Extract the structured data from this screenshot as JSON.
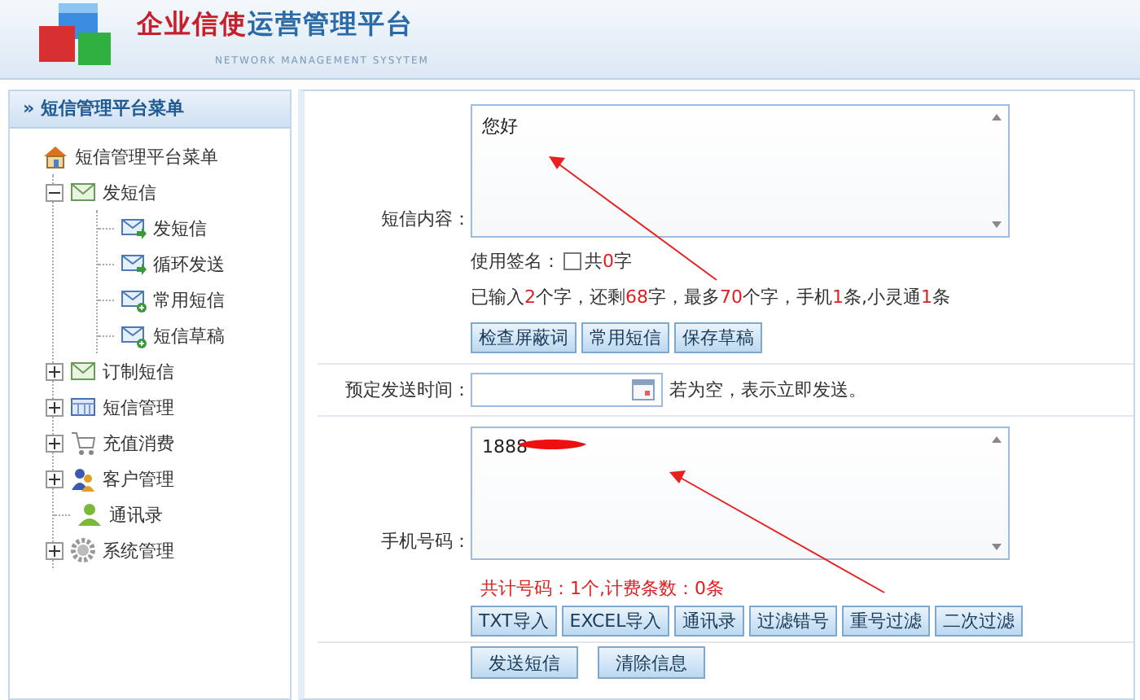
{
  "header": {
    "title_brand": "企业信使",
    "title_rest": "运营管理平台",
    "subtitle": "NETWORK MANAGEMENT SYSYTEM"
  },
  "sidebar": {
    "marker": "»",
    "title": "短信管理平台菜单",
    "tree": [
      {
        "label": "短信管理平台菜单",
        "kind": "home",
        "children": [
          {
            "label": "发短信",
            "kind": "mail",
            "expanded": true,
            "children": [
              {
                "label": "发短信",
                "kind": "mail-send"
              },
              {
                "label": "循环发送",
                "kind": "mail-send"
              },
              {
                "label": "常用短信",
                "kind": "mail-plus"
              },
              {
                "label": "短信草稿",
                "kind": "mail-plus"
              }
            ]
          },
          {
            "label": "订制短信",
            "kind": "mail",
            "expanded": false
          },
          {
            "label": "短信管理",
            "kind": "grid",
            "expanded": false
          },
          {
            "label": "充值消费",
            "kind": "cart",
            "expanded": false
          },
          {
            "label": "客户管理",
            "kind": "users",
            "expanded": false
          },
          {
            "label": "通讯录",
            "kind": "person"
          },
          {
            "label": "系统管理",
            "kind": "gear",
            "expanded": false
          }
        ]
      }
    ]
  },
  "form": {
    "content": {
      "label": "短信内容：",
      "value": "您好"
    },
    "signature": {
      "label": "使用签名：",
      "checked": false,
      "count": [
        {
          "text": "共",
          "highlight": false
        },
        {
          "text": "0",
          "highlight": true
        },
        {
          "text": "字",
          "highlight": false
        }
      ]
    },
    "stats": [
      {
        "text": "已输入",
        "highlight": false
      },
      {
        "text": "2",
        "highlight": true
      },
      {
        "text": "个字，还剩",
        "highlight": false
      },
      {
        "text": "68",
        "highlight": true
      },
      {
        "text": "字，最多",
        "highlight": false
      },
      {
        "text": "70",
        "highlight": true
      },
      {
        "text": "个字，手机",
        "highlight": false
      },
      {
        "text": "1",
        "highlight": true
      },
      {
        "text": "条,小灵通",
        "highlight": false
      },
      {
        "text": "1",
        "highlight": true
      },
      {
        "text": "条",
        "highlight": false
      }
    ],
    "content_buttons": [
      "检查屏蔽词",
      "常用短信",
      "保存草稿"
    ],
    "schedule": {
      "label": "预定发送时间：",
      "hint": "若为空，表示立即发送。"
    },
    "phones": {
      "label": "手机号码：",
      "value": "1888",
      "summary": "共计号码：1个,计费条数：0条"
    },
    "phone_buttons": [
      "TXT导入",
      "EXCEL导入",
      "通讯录",
      "过滤错号",
      "重号过滤",
      "二次过滤"
    ],
    "actions": [
      "发送短信",
      "清除信息"
    ]
  }
}
